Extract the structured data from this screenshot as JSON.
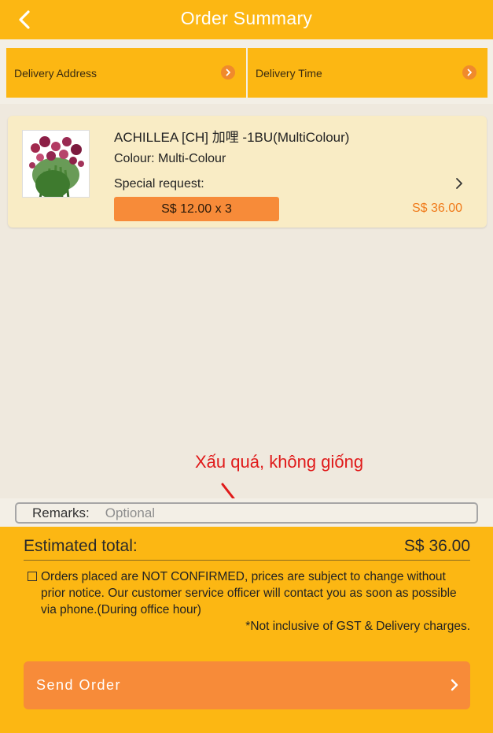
{
  "header": {
    "title": "Order Summary",
    "back_icon": "chevron-left-icon"
  },
  "tabs": [
    {
      "label": "Delivery Address",
      "icon": "chevron-right-circle-icon"
    },
    {
      "label": "Delivery Time",
      "icon": "chevron-right-circle-icon"
    }
  ],
  "item": {
    "name": "ACHILLEA [CH] 加哩  -1BU(MultiColour)",
    "colour": "Colour: Multi-Colour",
    "special_request": "Special request:",
    "qty_price": "S$ 12.00 x 3",
    "line_total": "S$ 36.00",
    "image_icon": "flower-bouquet-image"
  },
  "annotation": {
    "text": "Xấu quá, không giống"
  },
  "remarks": {
    "label": "Remarks:",
    "placeholder": "Optional"
  },
  "totals": {
    "label": "Estimated total:",
    "value": "S$ 36.00"
  },
  "notice": {
    "text": "Orders placed are NOT CONFIRMED, prices are subject to change without prior notice. Our customer service officer will contact you as soon as possible via phone.(During office hour)",
    "gst": "*Not inclusive of GST & Delivery charges."
  },
  "send": {
    "label": "Send Order"
  },
  "colors": {
    "primary_yellow": "#fcb713",
    "accent_orange": "#f78b39",
    "price_orange": "#f07a1a",
    "annotation_red": "#e01a1a",
    "background": "#efe9de"
  }
}
